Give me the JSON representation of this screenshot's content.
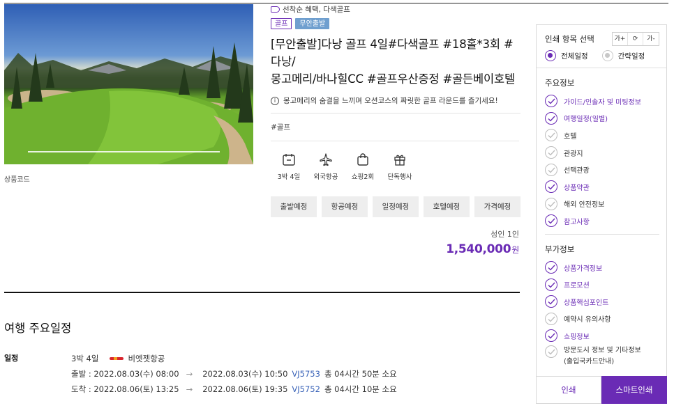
{
  "product": {
    "code_label": "상품코드",
    "benefit": "선착순 혜택, 다색골프",
    "badges": [
      "골프",
      "무안출발"
    ],
    "title_line1": "[무안출발]다낭 골프 4일#다색골프 #18홀*3회 #다낭/",
    "title_line2": "몽고메리/바나힐CC #골프우산증정 #골든베이호텔",
    "notice": "몽고메리의 숨결을 느끼며 오션코스의 짜릿한 골프 라운드를 즐기세요!",
    "hashtag": "#골프",
    "features": [
      {
        "icon": "calendar-icon",
        "label": "3박 4일"
      },
      {
        "icon": "airplane-icon",
        "label": "외국항공"
      },
      {
        "icon": "shopping-bag-icon",
        "label": "쇼핑2회"
      },
      {
        "icon": "gift-icon",
        "label": "단독행사"
      }
    ],
    "tabs": [
      "출발예정",
      "항공예정",
      "일정예정",
      "호텔예정",
      "가격예정"
    ],
    "price_label": "성인 1인",
    "price": "1,540,000",
    "price_unit": "원"
  },
  "itinerary": {
    "title": "여행 주요일정",
    "label": "일정",
    "duration": "3박 4일",
    "airline": "비엣젯항공",
    "departure": {
      "prefix": "출발 :",
      "from": "2022.08.03(수) 08:00",
      "arrow": "→",
      "to": "2022.08.03(수) 10:50",
      "flight": "VJ5753",
      "total": "총 04시간 50분 소요"
    },
    "arrival": {
      "prefix": "도착 :",
      "from": "2022.08.06(토) 13:25",
      "arrow": "→",
      "to": "2022.08.06(토) 19:35",
      "flight": "VJ5752",
      "total": "총 04시간 10분 소요"
    }
  },
  "print_panel": {
    "title": "인쇄 항목 선택",
    "font_up": "가+",
    "font_reset": "⟳",
    "font_down": "가-",
    "radio_full": "전체일정",
    "radio_brief": "간략일정",
    "main_title": "주요정보",
    "main_items": [
      {
        "label": "가이드/인솔자 및 미팅정보",
        "checked": true
      },
      {
        "label": "여행일정(일별)",
        "checked": true
      },
      {
        "label": "호텔",
        "checked": false
      },
      {
        "label": "관광지",
        "checked": false
      },
      {
        "label": "선택관광",
        "checked": false
      },
      {
        "label": "상품약관",
        "checked": true
      },
      {
        "label": "해외 안전정보",
        "checked": false
      },
      {
        "label": "참고사항",
        "checked": true
      }
    ],
    "extra_title": "부가정보",
    "extra_items": [
      {
        "label": "상품가격정보",
        "checked": true
      },
      {
        "label": "프로모션",
        "checked": true
      },
      {
        "label": "상품핵심포인트",
        "checked": true
      },
      {
        "label": "예약시 유의사항",
        "checked": false
      },
      {
        "label": "쇼핑정보",
        "checked": true
      }
    ],
    "visit_line1": "방문도시 정보 및 기타정보",
    "visit_line2": "(출입국카드안내)",
    "btn_print": "인쇄",
    "btn_smart": "스마트인쇄"
  },
  "colors": {
    "accent": "#6a2bb5",
    "badge_blue": "#6f9fcf",
    "flight_link": "#3a63b8"
  }
}
